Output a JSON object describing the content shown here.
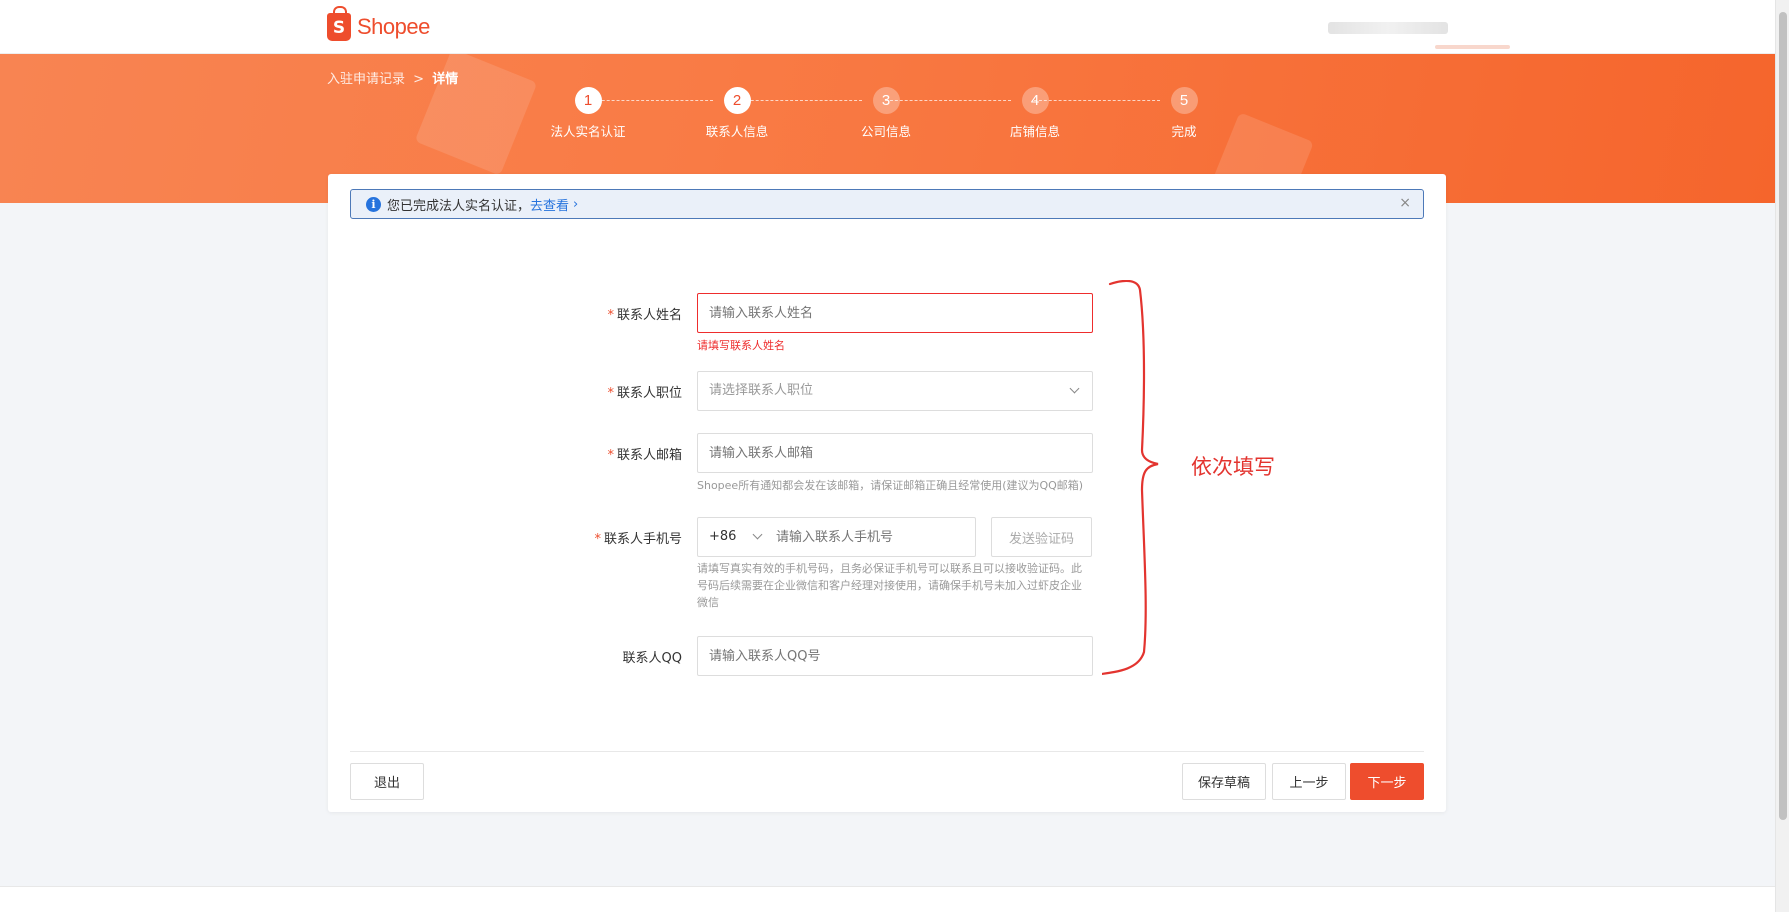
{
  "brand": {
    "name": "Shopee",
    "logo_letter": "S",
    "color": "#ee4d2d"
  },
  "breadcrumb": {
    "parent": "入驻申请记录",
    "separator": ">",
    "current": "详情"
  },
  "steps": [
    {
      "num": "1",
      "label": "法人实名认证",
      "state": "done"
    },
    {
      "num": "2",
      "label": "联系人信息",
      "state": "active"
    },
    {
      "num": "3",
      "label": "公司信息",
      "state": "todo"
    },
    {
      "num": "4",
      "label": "店铺信息",
      "state": "todo"
    },
    {
      "num": "5",
      "label": "完成",
      "state": "todo"
    }
  ],
  "alert": {
    "text": "您已完成法人实名认证，",
    "link": "去查看",
    "icon": "info-icon",
    "close_icon": "close-icon",
    "close_glyph": "×"
  },
  "form": {
    "required_mark": "*",
    "name": {
      "label": "联系人姓名",
      "placeholder": "请输入联系人姓名",
      "error": "请填写联系人姓名"
    },
    "position": {
      "label": "联系人职位",
      "placeholder": "请选择联系人职位"
    },
    "email": {
      "label": "联系人邮箱",
      "placeholder": "请输入联系人邮箱",
      "hint": "Shopee所有通知都会发在该邮箱，请保证邮箱正确且经常使用(建议为QQ邮箱)"
    },
    "phone": {
      "label": "联系人手机号",
      "prefix": "+86",
      "placeholder": "请输入联系人手机号",
      "send_code": "发送验证码",
      "hint_lines": [
        "请填写真实有效的手机号码，且务必保证手机号可以联系且可以接收验证码。此",
        "号码后续需要在企业微信和客户经理对接使用，请确保手机号未加入过虾皮企业",
        "微信"
      ]
    },
    "qq": {
      "label": "联系人QQ",
      "placeholder": "请输入联系人QQ号"
    }
  },
  "footer": {
    "exit": "退出",
    "save_draft": "保存草稿",
    "prev": "上一步",
    "next": "下一步"
  },
  "annotation": {
    "text": "依次填写",
    "color": "#e3342f"
  }
}
